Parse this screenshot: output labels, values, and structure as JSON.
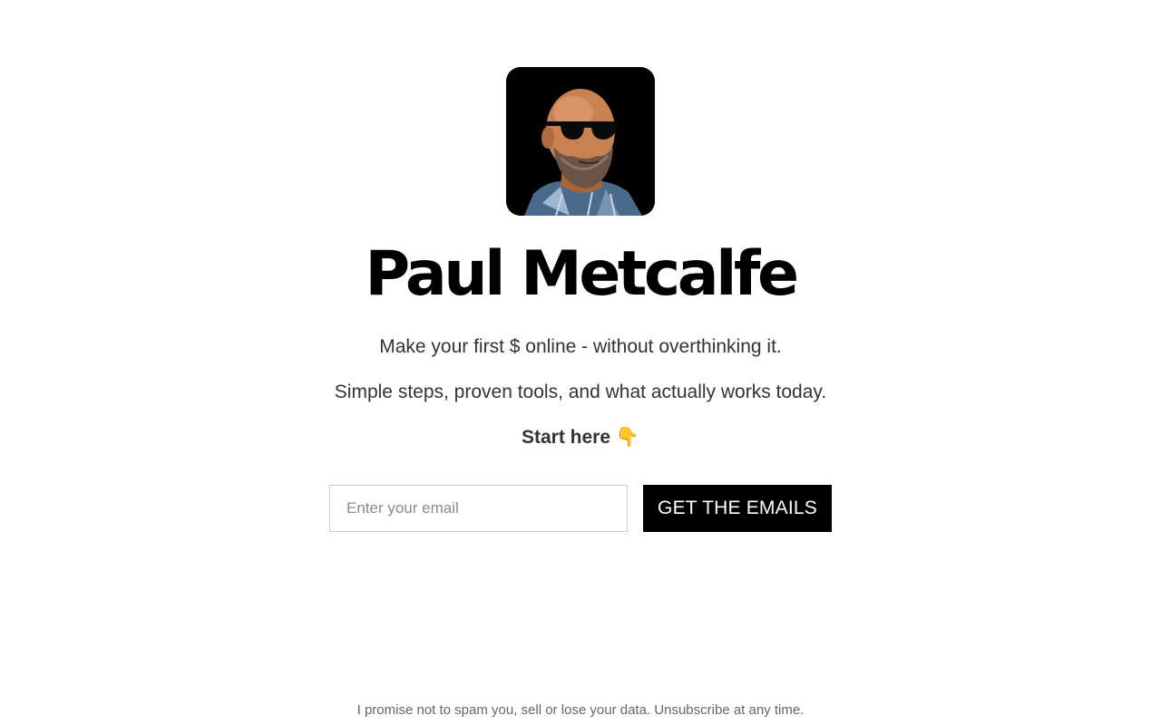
{
  "profile": {
    "name": "Paul Metcalfe",
    "avatar_icon": "profile-photo"
  },
  "tagline": {
    "line1": "Make your first $ online - without overthinking it.",
    "line2": "Simple steps, proven tools, and what actually works today.",
    "cta_prompt": "Start here 👇"
  },
  "signup": {
    "email_placeholder": "Enter your email",
    "email_value": "",
    "button_label": "GET THE EMAILS"
  },
  "footer": {
    "privacy_note": "I promise not to spam you, sell or lose your data. Unsubscribe at any time."
  },
  "colors": {
    "background": "#ffffff",
    "button_bg": "#000000",
    "button_text": "#ffffff",
    "heading": "#000000",
    "body_text": "#333333",
    "muted_text": "#666666"
  }
}
